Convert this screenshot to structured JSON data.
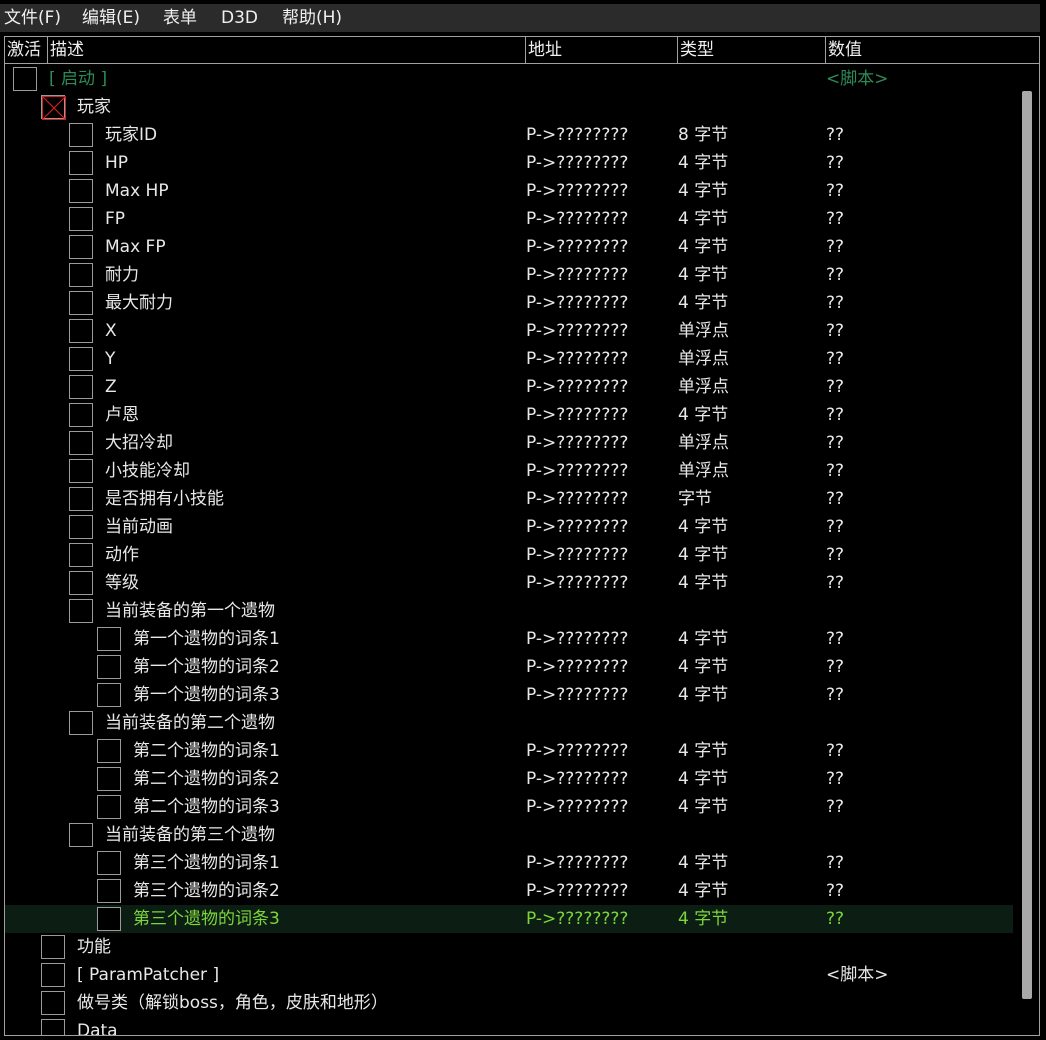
{
  "menu": [
    {
      "label": "文件(F)"
    },
    {
      "label": "编辑(E)"
    },
    {
      "label": "表单"
    },
    {
      "label": "D3D"
    },
    {
      "label": "帮助(H)"
    }
  ],
  "columns": {
    "active": "激活",
    "description": "描述",
    "address": "地址",
    "type": "类型",
    "value": "数值"
  },
  "rows": [
    {
      "level": 0,
      "desc": "[ 启动 ]",
      "addr": "",
      "type": "",
      "value": "<脚本>",
      "style": "script-green"
    },
    {
      "level": 1,
      "desc": "玩家",
      "addr": "",
      "type": "",
      "value": "",
      "crossed": true
    },
    {
      "level": 2,
      "desc": "玩家ID",
      "addr": "P->????????",
      "type": "8 字节",
      "value": "??"
    },
    {
      "level": 2,
      "desc": "HP",
      "addr": "P->????????",
      "type": "4 字节",
      "value": "??"
    },
    {
      "level": 2,
      "desc": "Max HP",
      "addr": "P->????????",
      "type": "4 字节",
      "value": "??"
    },
    {
      "level": 2,
      "desc": "FP",
      "addr": "P->????????",
      "type": "4 字节",
      "value": "??"
    },
    {
      "level": 2,
      "desc": "Max FP",
      "addr": "P->????????",
      "type": "4 字节",
      "value": "??"
    },
    {
      "level": 2,
      "desc": "耐力",
      "addr": "P->????????",
      "type": "4 字节",
      "value": "??"
    },
    {
      "level": 2,
      "desc": "最大耐力",
      "addr": "P->????????",
      "type": "4 字节",
      "value": "??"
    },
    {
      "level": 2,
      "desc": "X",
      "addr": "P->????????",
      "type": "单浮点",
      "value": "??"
    },
    {
      "level": 2,
      "desc": "Y",
      "addr": "P->????????",
      "type": "单浮点",
      "value": "??"
    },
    {
      "level": 2,
      "desc": "Z",
      "addr": "P->????????",
      "type": "单浮点",
      "value": "??"
    },
    {
      "level": 2,
      "desc": "卢恩",
      "addr": "P->????????",
      "type": "4 字节",
      "value": "??"
    },
    {
      "level": 2,
      "desc": "大招冷却",
      "addr": "P->????????",
      "type": "单浮点",
      "value": "??"
    },
    {
      "level": 2,
      "desc": "小技能冷却",
      "addr": "P->????????",
      "type": "单浮点",
      "value": "??"
    },
    {
      "level": 2,
      "desc": "是否拥有小技能",
      "addr": "P->????????",
      "type": "字节",
      "value": "??"
    },
    {
      "level": 2,
      "desc": "当前动画",
      "addr": "P->????????",
      "type": "4 字节",
      "value": "??"
    },
    {
      "level": 2,
      "desc": "动作",
      "addr": "P->????????",
      "type": "4 字节",
      "value": "??"
    },
    {
      "level": 2,
      "desc": "等级",
      "addr": "P->????????",
      "type": "4 字节",
      "value": "??"
    },
    {
      "level": 2,
      "desc": "当前装备的第一个遗物",
      "addr": "",
      "type": "",
      "value": ""
    },
    {
      "level": 3,
      "desc": "第一个遗物的词条1",
      "addr": "P->????????",
      "type": "4 字节",
      "value": "??"
    },
    {
      "level": 3,
      "desc": "第一个遗物的词条2",
      "addr": "P->????????",
      "type": "4 字节",
      "value": "??"
    },
    {
      "level": 3,
      "desc": "第一个遗物的词条3",
      "addr": "P->????????",
      "type": "4 字节",
      "value": "??"
    },
    {
      "level": 2,
      "desc": "当前装备的第二个遗物",
      "addr": "",
      "type": "",
      "value": ""
    },
    {
      "level": 3,
      "desc": "第二个遗物的词条1",
      "addr": "P->????????",
      "type": "4 字节",
      "value": "??"
    },
    {
      "level": 3,
      "desc": "第二个遗物的词条2",
      "addr": "P->????????",
      "type": "4 字节",
      "value": "??"
    },
    {
      "level": 3,
      "desc": "第二个遗物的词条3",
      "addr": "P->????????",
      "type": "4 字节",
      "value": "??"
    },
    {
      "level": 2,
      "desc": "当前装备的第三个遗物",
      "addr": "",
      "type": "",
      "value": ""
    },
    {
      "level": 3,
      "desc": "第三个遗物的词条1",
      "addr": "P->????????",
      "type": "4 字节",
      "value": "??"
    },
    {
      "level": 3,
      "desc": "第三个遗物的词条2",
      "addr": "P->????????",
      "type": "4 字节",
      "value": "??"
    },
    {
      "level": 3,
      "desc": "第三个遗物的词条3",
      "addr": "P->????????",
      "type": "4 字节",
      "value": "??",
      "selected": true
    },
    {
      "level": 1,
      "desc": "功能",
      "addr": "",
      "type": "",
      "value": ""
    },
    {
      "level": 1,
      "desc": "[ ParamPatcher ]",
      "addr": "",
      "type": "",
      "value": "<脚本>"
    },
    {
      "level": 1,
      "desc": "做号类（解锁boss，角色，皮肤和地形）",
      "addr": "",
      "type": "",
      "value": ""
    },
    {
      "level": 1,
      "desc": "Data",
      "addr": "",
      "type": "",
      "value": ""
    }
  ],
  "colors": {
    "background": "#000000",
    "text": "#e8e8e8",
    "script_green": "#2e8b57",
    "selected_text": "#7cd63a",
    "selected_bg": "#0c1e14",
    "cross": "#cc2222"
  }
}
